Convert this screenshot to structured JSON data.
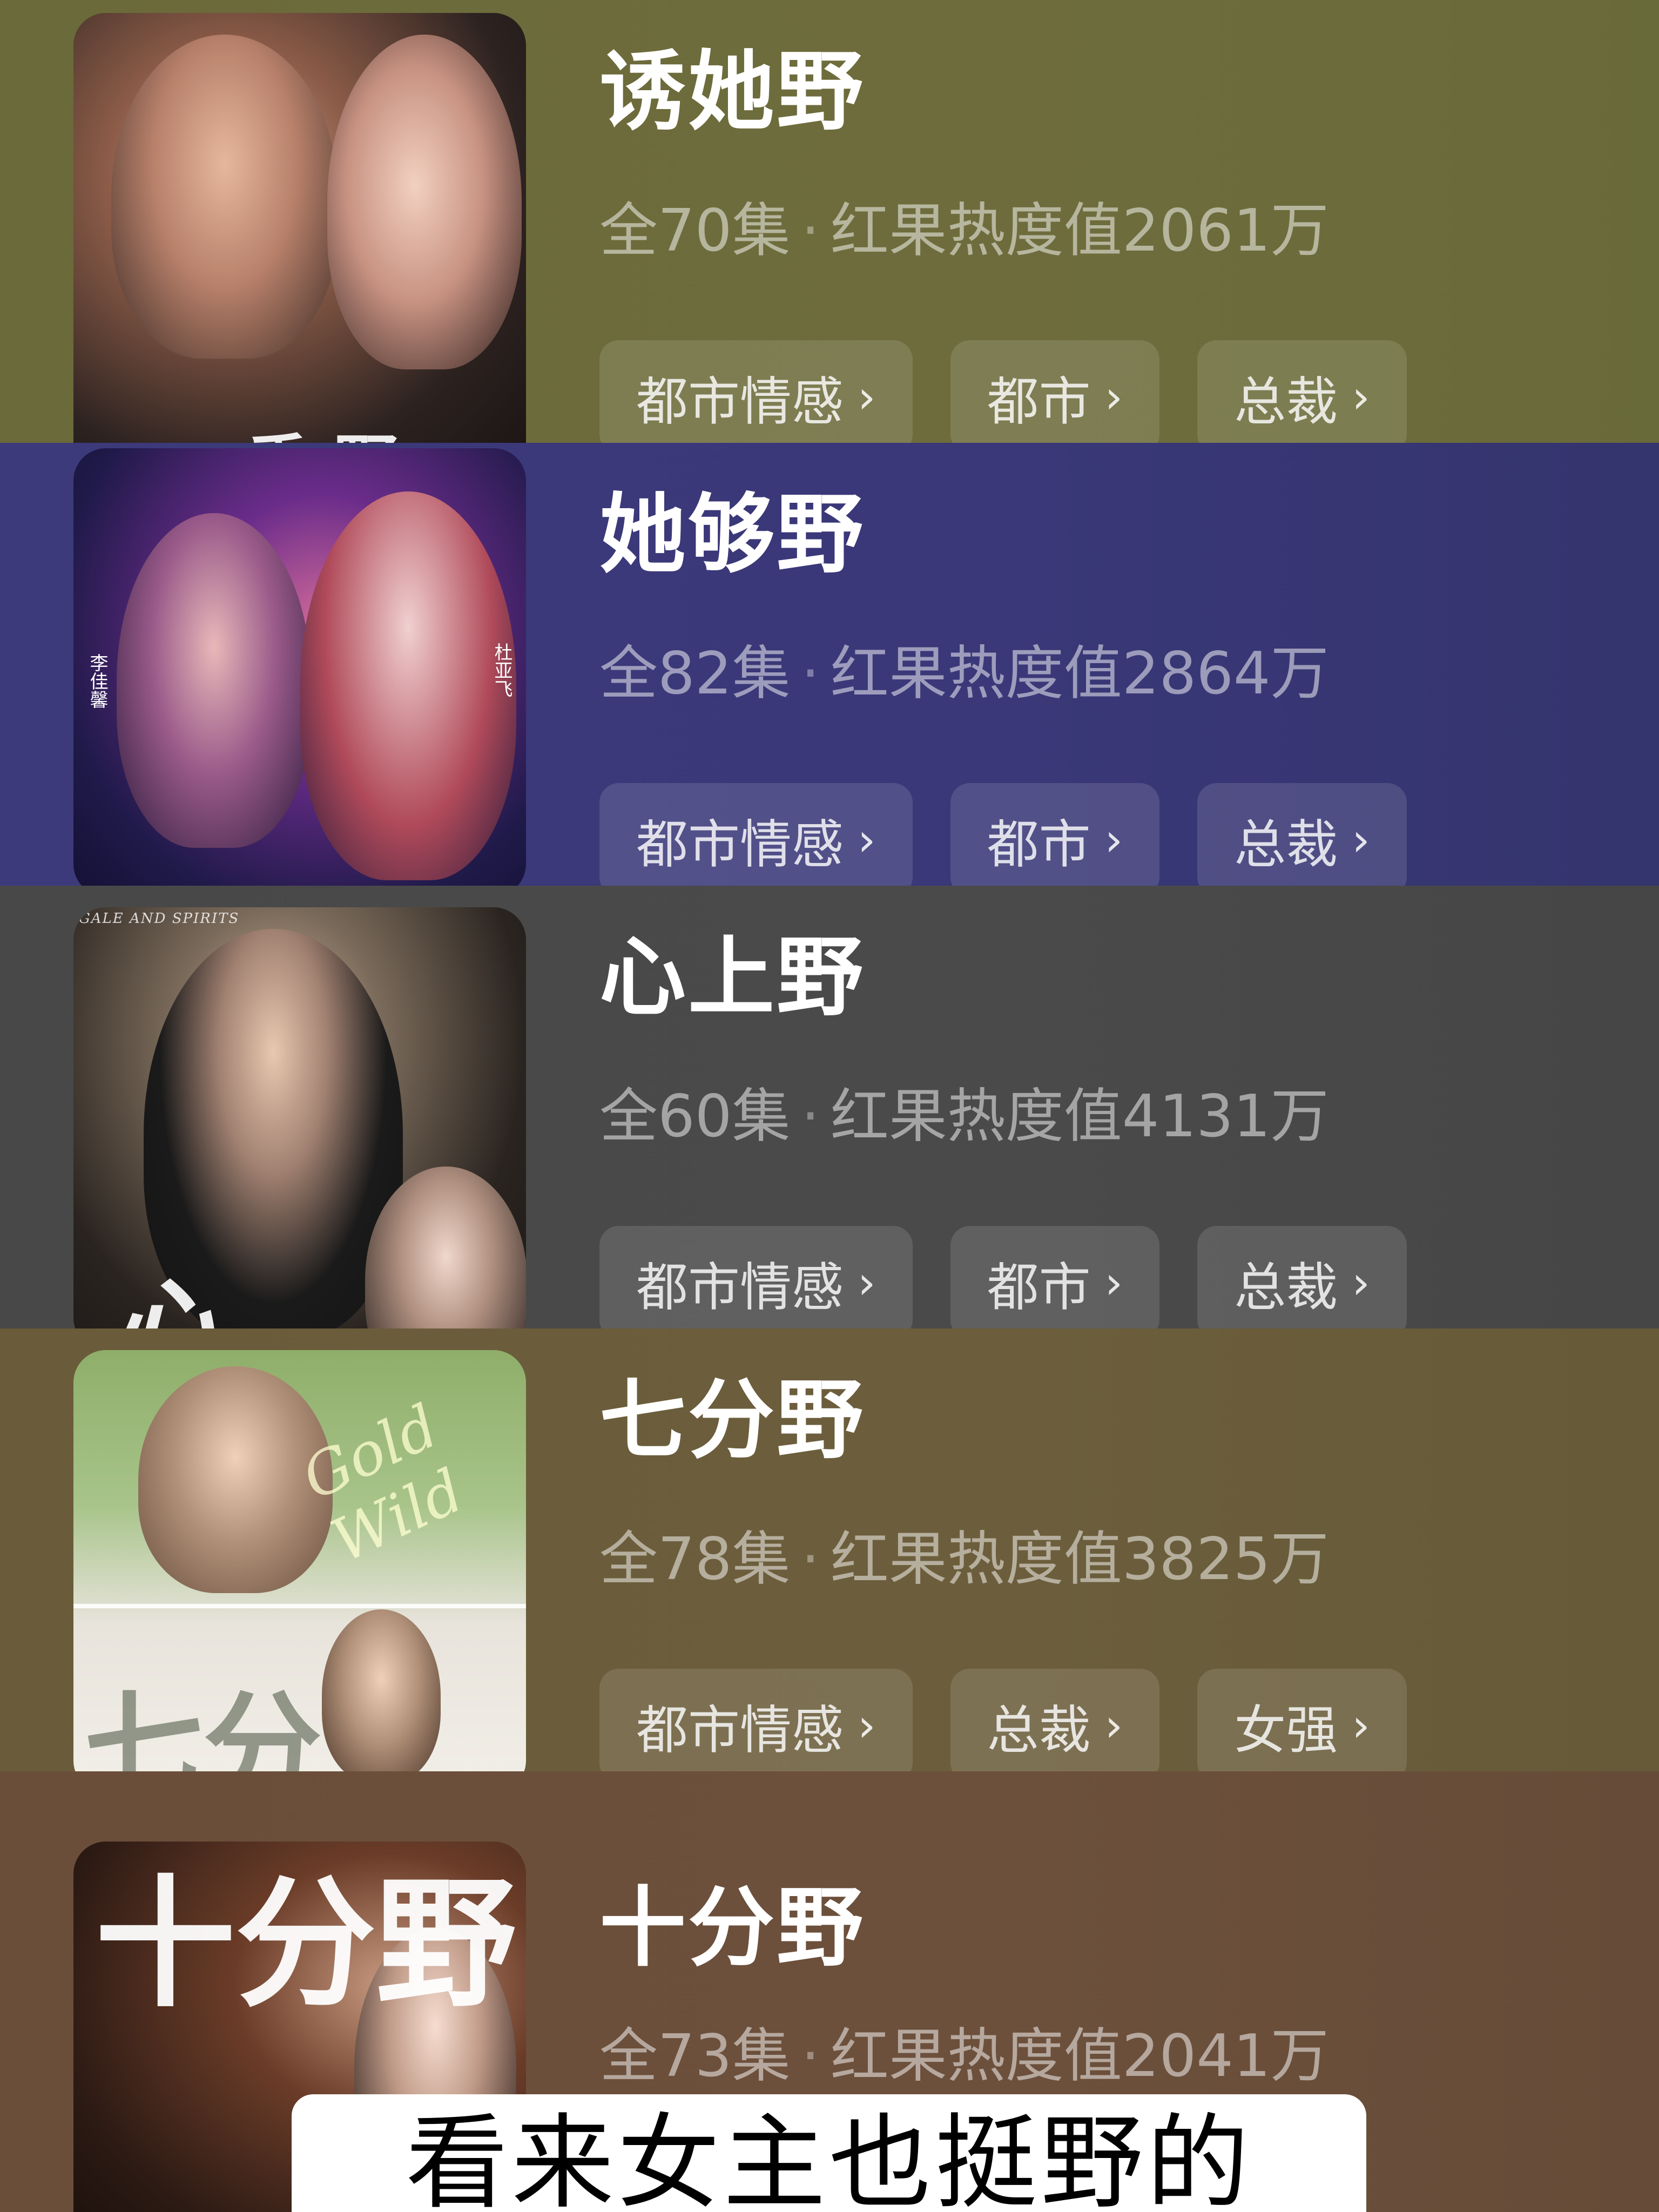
{
  "dramas": [
    {
      "title": "诱她野",
      "episodes": "全70集",
      "heat": "红果热度值2061万",
      "tags": [
        "都市情感",
        "都市",
        "总裁"
      ],
      "poster_text": "秀 野"
    },
    {
      "title": "她够野",
      "episodes": "全82集",
      "heat": "红果热度值2864万",
      "tags": [
        "都市情感",
        "都市",
        "总裁"
      ],
      "poster_text_left": "李佳馨",
      "poster_text_right": "杜亚飞"
    },
    {
      "title": "心上野",
      "episodes": "全60集",
      "heat": "红果热度值4131万",
      "tags": [
        "都市情感",
        "都市",
        "总裁"
      ],
      "poster_text": "心",
      "poster_top_text": "GALE AND SPIRITS"
    },
    {
      "title": "七分野",
      "episodes": "全78集",
      "heat": "红果热度值3825万",
      "tags": [
        "都市情感",
        "总裁",
        "女强"
      ],
      "poster_text": "七分",
      "poster_script": "Gold Wild"
    },
    {
      "title": "十分野",
      "episodes": "全73集",
      "heat": "红果热度值2041万",
      "poster_text": "十分野"
    }
  ],
  "separator": "·",
  "tag_chevron": "›",
  "subtitle": "看来女主也挺野的"
}
